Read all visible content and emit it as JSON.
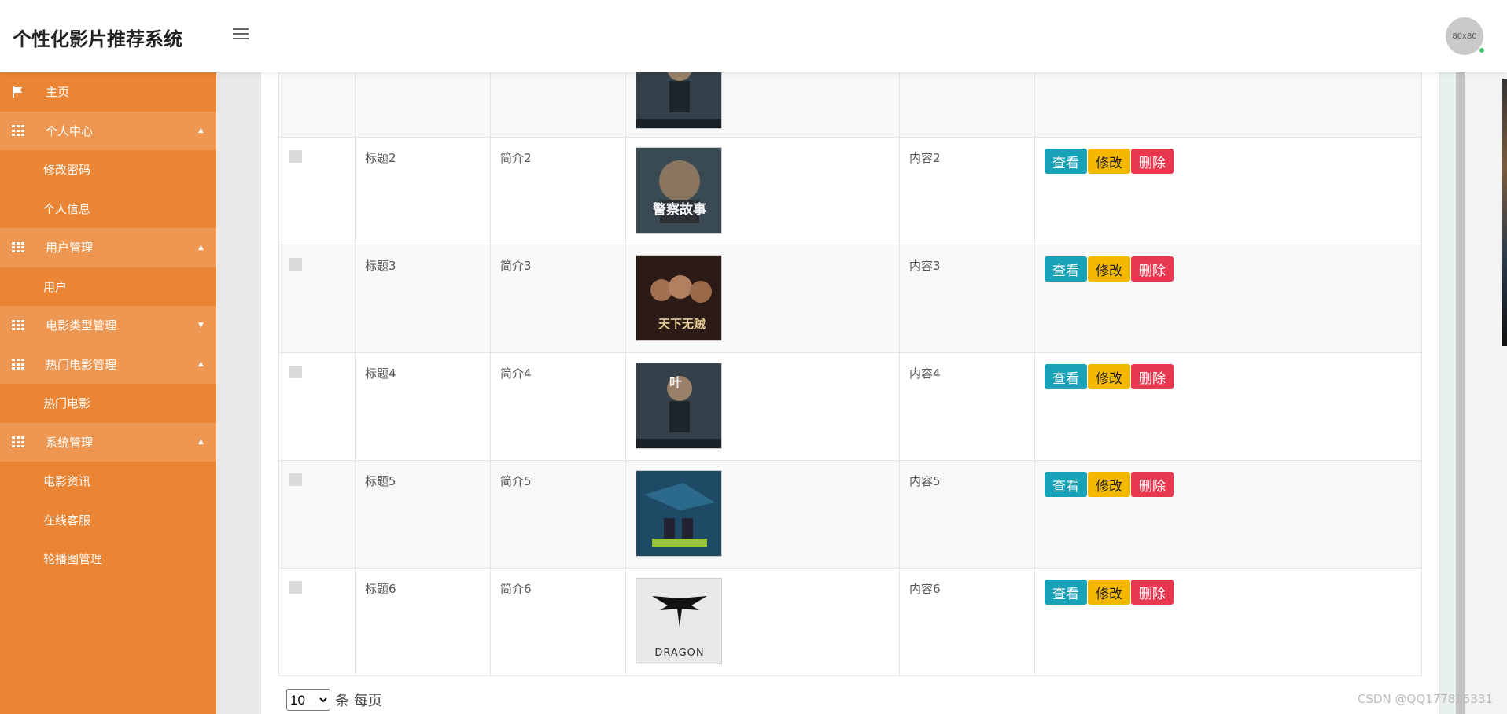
{
  "header": {
    "title": "个性化影片推荐系统",
    "avatar_text": "80x80"
  },
  "sidebar": {
    "items": [
      {
        "label": "主页",
        "type": "top",
        "icon": "flag-icon"
      },
      {
        "label": "个人中心",
        "type": "group",
        "icon": "grid-icon",
        "arrow": "▲"
      },
      {
        "label": "修改密码",
        "type": "sub"
      },
      {
        "label": "个人信息",
        "type": "sub"
      },
      {
        "label": "用户管理",
        "type": "group",
        "icon": "grid-icon",
        "arrow": "▲"
      },
      {
        "label": "用户",
        "type": "sub"
      },
      {
        "label": "电影类型管理",
        "type": "group",
        "icon": "grid-icon",
        "arrow": "▼"
      },
      {
        "label": "热门电影管理",
        "type": "group",
        "icon": "grid-icon",
        "arrow": "▲"
      },
      {
        "label": "热门电影",
        "type": "sub"
      },
      {
        "label": "系统管理",
        "type": "group",
        "icon": "grid-icon",
        "arrow": "▲"
      },
      {
        "label": "电影资讯",
        "type": "sub"
      },
      {
        "label": "在线客服",
        "type": "sub"
      },
      {
        "label": "轮播图管理",
        "type": "sub"
      }
    ]
  },
  "table": {
    "rows": [
      {
        "title": "",
        "intro": "",
        "content": "",
        "poster": "ip-man"
      },
      {
        "title": "标题2",
        "intro": "简介2",
        "content": "内容2",
        "poster": "police-story"
      },
      {
        "title": "标题3",
        "intro": "简介3",
        "content": "内容3",
        "poster": "dark-group"
      },
      {
        "title": "标题4",
        "intro": "简介4",
        "content": "内容4",
        "poster": "ip-man"
      },
      {
        "title": "标题5",
        "intro": "简介5",
        "content": "内容5",
        "poster": "blue-action"
      },
      {
        "title": "标题6",
        "intro": "简介6",
        "content": "内容6",
        "poster": "dragon"
      }
    ],
    "actions": {
      "view": "查看",
      "edit": "修改",
      "delete": "删除"
    }
  },
  "poster_text": {
    "police-story": "警察故事",
    "dark-group": "天下无贼",
    "ip-man": "叶",
    "dragon": "DRAGON"
  },
  "pager": {
    "page_size": "10",
    "suffix": "条 每页"
  },
  "watermark": "CSDN @QQ177825331",
  "colors": {
    "sidebar": "#ea8535",
    "sidebar_group": "#ee9752",
    "view": "#17a2b8",
    "edit": "#f5b800",
    "delete": "#e8384f"
  }
}
